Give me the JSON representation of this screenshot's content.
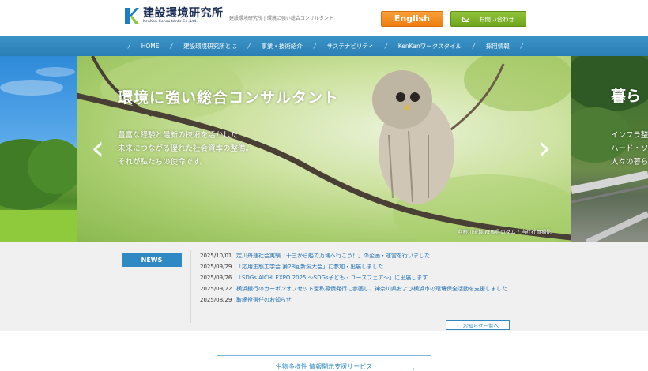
{
  "header": {
    "logo_main": "建設環境研究所",
    "logo_sub": "KenKan Consultants Co.,Ltd.",
    "tagline": "建設環境研究所 | 環境に強い総合コンサルタント",
    "english_label": "English",
    "contact_label": "お問い合わせ",
    "logo_colors": {
      "blue": "#1a7fc4",
      "green": "#8cc53f",
      "navy": "#1a2e57"
    }
  },
  "nav": {
    "items": [
      {
        "label": "HOME"
      },
      {
        "label": "建設環境研究所とは"
      },
      {
        "label": "事業・技術紹介"
      },
      {
        "label": "サステナビリティ"
      },
      {
        "label": "KenKanワークスタイル"
      },
      {
        "label": "採用情報"
      }
    ],
    "color": "#2f86bd"
  },
  "hero": {
    "title": "環境に強い総合コンサルタント",
    "body_line1": "豊富な経験と最新の技術を活かした",
    "body_line2": "未来につながる優れた社会資本の整備。",
    "body_line3": "それが私たちの使命です。",
    "caption": "利根川流域 群馬県のダム / 当社社員撮影",
    "right_title": "暮ら",
    "right_line1": "インフラ整",
    "right_line2": "ハード・ソ",
    "right_line3": "人々の暮ら"
  },
  "news": {
    "label": "NEWS",
    "items": [
      {
        "date": "2025/10/01",
        "text": "定川舟運社会実験「十三から船で万博へ行こう！」の企画・運営を行いました"
      },
      {
        "date": "2025/09/29",
        "text": "「応用生態工学会 第28回新潟大会」に参加・出展しました"
      },
      {
        "date": "2025/09/26",
        "text": "「SDGs AICHI EXPO 2025 〜SDGs子ども・ユースフェア〜」に出展します"
      },
      {
        "date": "2025/09/22",
        "text": "横浜銀行のカーボンオフセット型私募債発行に参画し、神奈川県および横浜市の環境保全活動を支援しました"
      },
      {
        "date": "2025/08/29",
        "text": "取締役選任のお知らせ"
      }
    ],
    "more_label": "お知らせ一覧へ"
  },
  "service": {
    "label": "生物多様性 情報開示支援サービス"
  }
}
